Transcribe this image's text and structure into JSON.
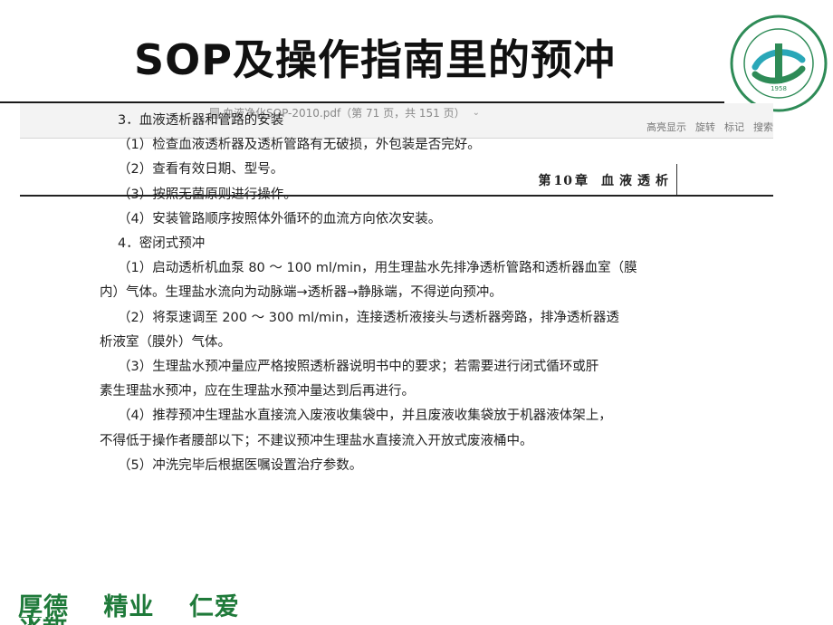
{
  "slide": {
    "title": "SOP及操作指南里的预冲",
    "motto": [
      "厚德",
      "精业",
      "仁爱"
    ],
    "motto_cut": "求新"
  },
  "logo": {
    "ring_text": "湖北省中西医结合医院",
    "year": "1958",
    "english": "Hubei Provincial Hospital of Integrated Chinese & Western Medicine",
    "colors": {
      "ring": "#2e8b57",
      "accent": "#2aa7b8"
    }
  },
  "pdf_viewer": {
    "filename": "血液净化SOP-2010.pdf（第 71 页，共 151 页）",
    "tools": [
      "高亮显示",
      "旋转",
      "标记",
      "搜索"
    ],
    "chapter_label": "第",
    "chapter_num": "10",
    "chapter_label2": "章",
    "chapter_title": "血液透析"
  },
  "content": {
    "section3_title": "3．血液透析器和管路的安装",
    "s3_items": [
      "（1）检查血液透析器及透析管路有无破损，外包装是否完好。",
      "（2）查看有效日期、型号。",
      "（3）按照无菌原则进行操作。",
      "（4）安装管路顺序按照体外循环的血流方向依次安装。"
    ],
    "section4_title": "4．密闭式预冲",
    "s4_item1_l1": "（1）启动透析机血泵 80 ～ 100 ml/min，用生理盐水先排净透析管路和透析器血室（膜",
    "s4_item1_l2": "内）气体。生理盐水流向为动脉端→透析器→静脉端，不得逆向预冲。",
    "s4_item2_l1": "（2）将泵速调至 200 ～ 300 ml/min，连接透析液接头与透析器旁路，排净透析器透",
    "s4_item2_l2": "析液室（膜外）气体。",
    "s4_item3_l1": "（3）生理盐水预冲量应严格按照透析器说明书中的要求；若需要进行闭式循环或肝",
    "s4_item3_l2": "素生理盐水预冲，应在生理盐水预冲量达到后再进行。",
    "s4_item4_l1": "（4）推荐预冲生理盐水直接流入废液收集袋中，并且废液收集袋放于机器液体架上，",
    "s4_item4_l2": "不得低于操作者腰部以下；不建议预冲生理盐水直接流入开放式废液桶中。",
    "s4_item5": "（5）冲洗完毕后根据医嘱设置治疗参数。"
  }
}
